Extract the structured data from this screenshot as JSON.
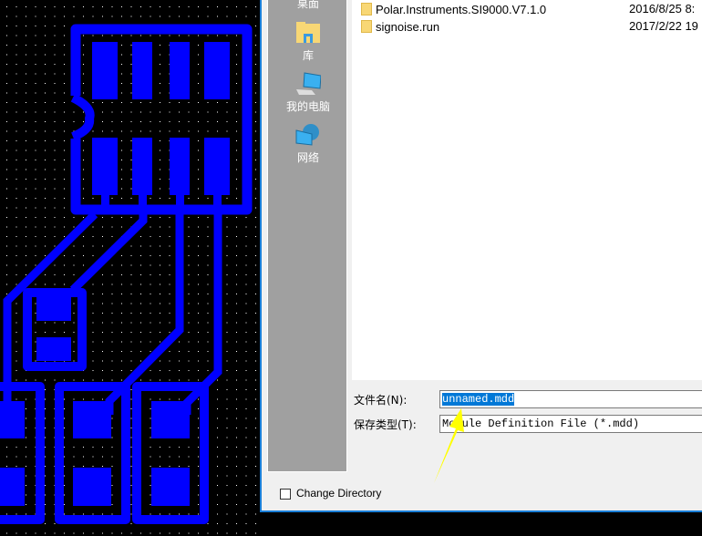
{
  "colors": {
    "copper": "#0000ff",
    "background": "#000000",
    "grid_dot": "#ffffff",
    "arrow": "#ffff00",
    "selection": "#0078d7"
  },
  "places": [
    {
      "label": "桌面",
      "icon": "desktop-icon"
    },
    {
      "label": "库",
      "icon": "library-folder-icon"
    },
    {
      "label": "我的电脑",
      "icon": "computer-icon"
    },
    {
      "label": "网络",
      "icon": "network-icon"
    }
  ],
  "files": [
    {
      "name": "Polar.Instruments.SI9000.V7.1.0",
      "date": "2016/8/25 8:"
    },
    {
      "name": "signoise.run",
      "date": "2017/2/22 19"
    }
  ],
  "form": {
    "filename_label": "文件名(N):",
    "filename_value": "unnamed.mdd",
    "filetype_label": "保存类型(T):",
    "filetype_value": "Module Definition File (*.mdd)",
    "change_directory_label": "Change Directory",
    "change_directory_checked": false
  }
}
